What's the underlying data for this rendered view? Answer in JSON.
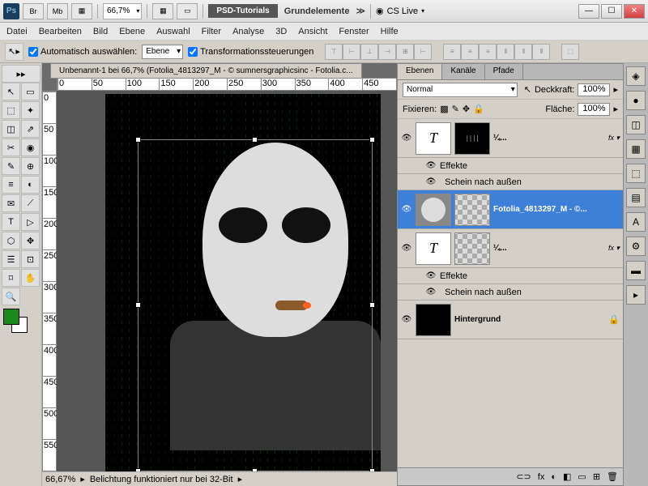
{
  "app_icon": "Ps",
  "titlebar": {
    "btn_br": "Br",
    "btn_mb": "Mb",
    "zoom": "66,7%",
    "label_tutorials": "PSD-Tutorials",
    "label_grund": "Grundelemente",
    "cslive": "CS Live"
  },
  "menu": [
    "Datei",
    "Bearbeiten",
    "Bild",
    "Ebene",
    "Auswahl",
    "Filter",
    "Analyse",
    "3D",
    "Ansicht",
    "Fenster",
    "Hilfe"
  ],
  "options": {
    "auto_select": "Automatisch auswählen:",
    "auto_target": "Ebene",
    "transform": "Transformationssteuerungen"
  },
  "doc_title": "Unbenannt-1 bei 66,7% (Fotolia_4813297_M - © sumnersgraphicsinc - Fotolia.c...",
  "ruler_h": [
    "0",
    "50",
    "100",
    "150",
    "200",
    "250",
    "300",
    "350",
    "400",
    "450"
  ],
  "ruler_v": [
    "0",
    "50",
    "100",
    "150",
    "200",
    "250",
    "300",
    "350",
    "400",
    "450",
    "500",
    "550"
  ],
  "tools": [
    "↖",
    "▭",
    "⬚",
    "✦",
    "◫",
    "⇗",
    "✂",
    "◉",
    "✎",
    "⊕",
    "≡",
    "◐",
    "✉",
    "⟋",
    "T",
    "▷",
    "⬡",
    "✥",
    "☰",
    "⊡",
    "⌑",
    "✋",
    "🔍"
  ],
  "fg_color": "#1a8a1a",
  "status": {
    "zoom": "66,67%",
    "msg": "Belichtung funktioniert nur bei 32-Bit"
  },
  "panel": {
    "tabs": [
      "Ebenen",
      "Kanäle",
      "Pfade"
    ],
    "blend": "Normal",
    "opacity_lbl": "Deckkraft:",
    "opacity": "100%",
    "lock_lbl": "Fixieren:",
    "fill_lbl": "Fläche:",
    "fill": "100%",
    "layers": [
      {
        "kind": "text",
        "mask": "stripes",
        "name": "¼...",
        "fx": "fx"
      },
      {
        "kind": "fxrow",
        "name": "Effekte"
      },
      {
        "kind": "fxsub",
        "name": "Schein nach außen"
      },
      {
        "kind": "image",
        "selected": true,
        "name": "Fotolia_4813297_M - ©..."
      },
      {
        "kind": "text",
        "mask": "marble",
        "name": "¼...",
        "fx": "fx"
      },
      {
        "kind": "fxrow",
        "name": "Effekte"
      },
      {
        "kind": "fxsub",
        "name": "Schein nach außen"
      },
      {
        "kind": "bg",
        "name": "Hintergrund"
      }
    ],
    "foot_icons": [
      "⊂⊃",
      "fx",
      "◐",
      "◧",
      "▭",
      "⊞",
      "🗑"
    ]
  },
  "dock": [
    "◈",
    "●",
    "◫",
    "▦",
    "⬚",
    "▤",
    "A",
    "⚙",
    "▬",
    "▸"
  ]
}
